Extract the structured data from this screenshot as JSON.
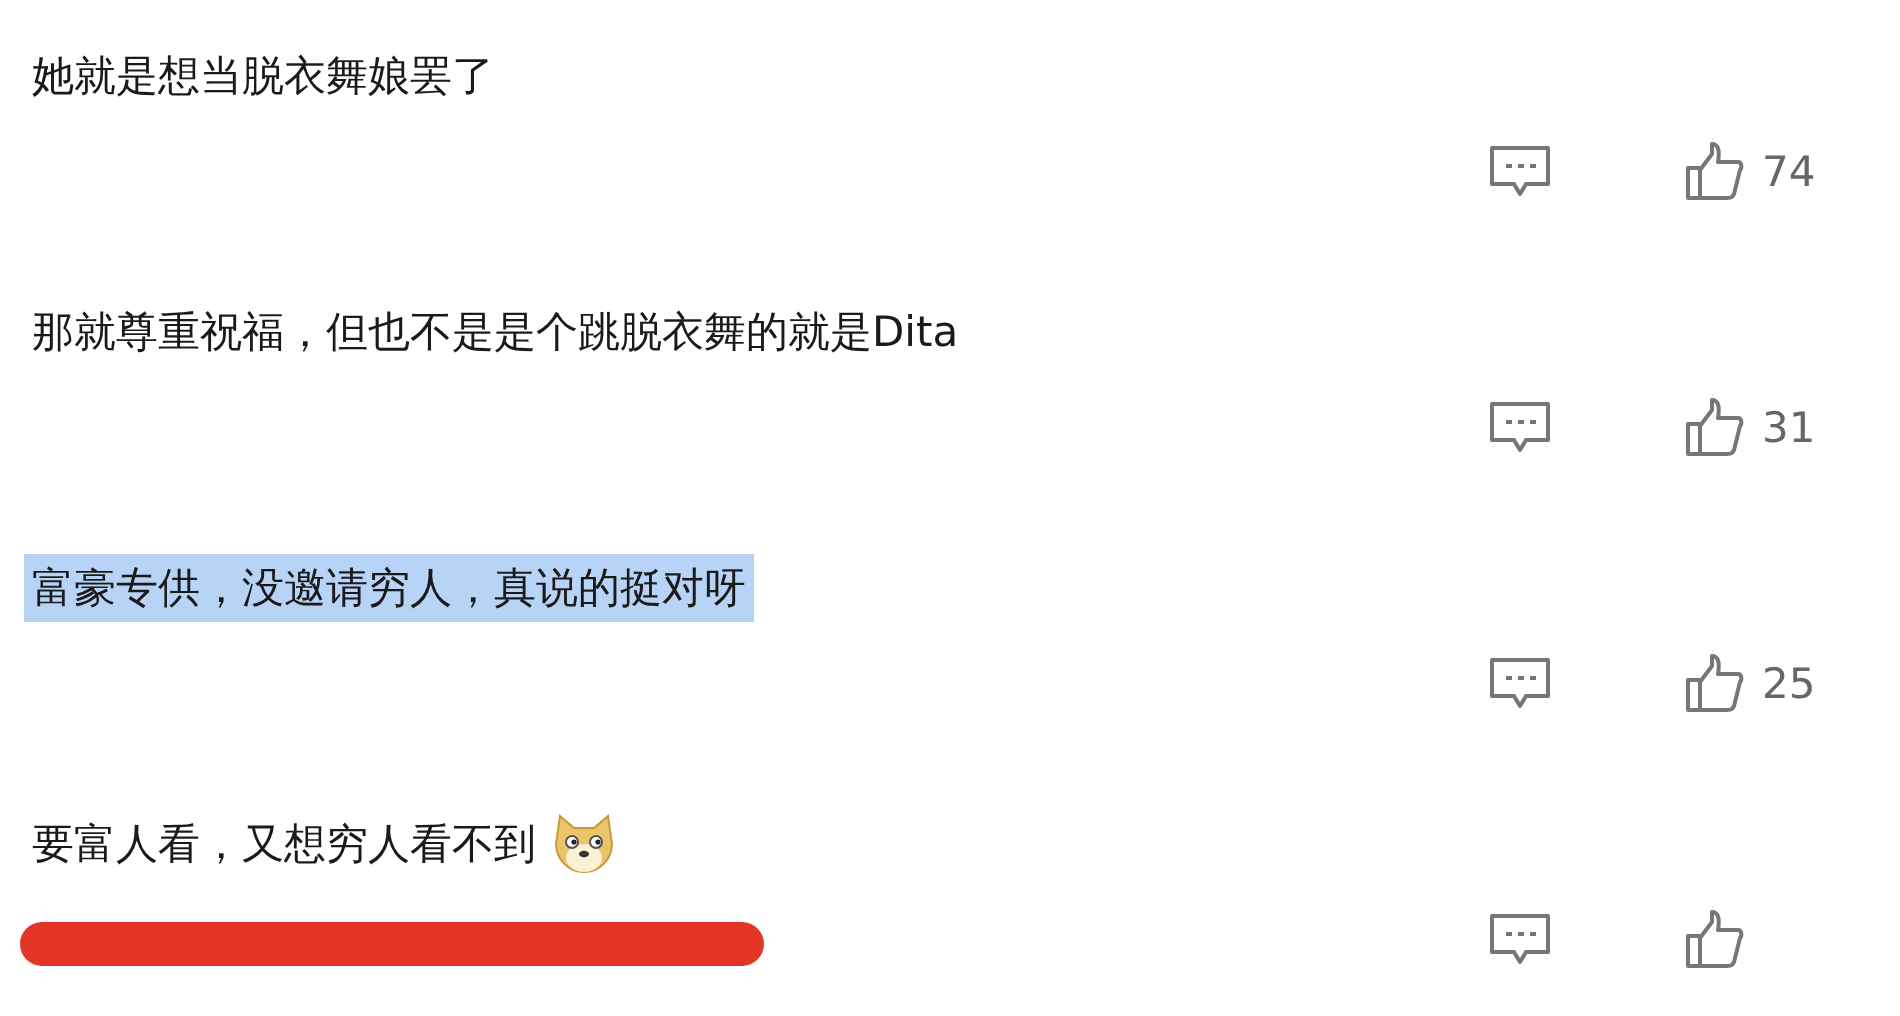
{
  "comments": [
    {
      "text": "她就是想当脱衣舞娘罢了",
      "highlighted": false,
      "likes": "74"
    },
    {
      "text": "那就尊重祝福，但也不是是个跳脱衣舞的就是Dita",
      "highlighted": false,
      "likes": "31"
    },
    {
      "text": "富豪专供，没邀请穷人，真说的挺对呀",
      "highlighted": true,
      "likes": "25"
    },
    {
      "text": "要富人看，又想穷人看不到",
      "highlighted": false,
      "underlined": true,
      "emoji": true
    }
  ]
}
